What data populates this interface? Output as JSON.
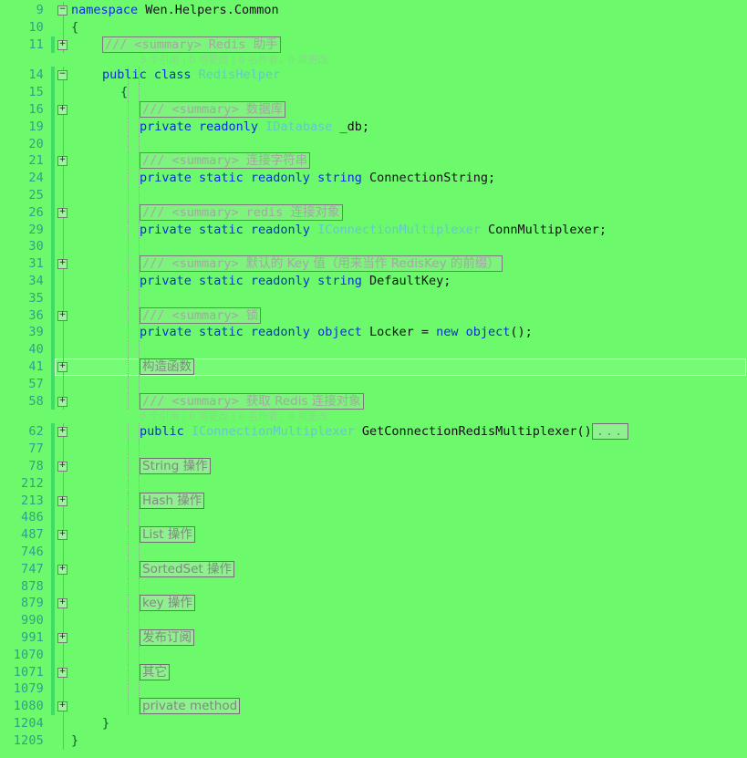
{
  "editor": {
    "app": "visual-studio-code-editor",
    "language": "csharp",
    "background_color": "#6cf96c",
    "keyword_color": "#0a2fd8",
    "type_color": "#66c9c9",
    "text_color": "#101010",
    "linenumber_color": "#2f9f8f",
    "collapsed_text_color": "#7f8a7f",
    "current_line": "41"
  },
  "lines": [
    {
      "num": "9",
      "glyph": "minus",
      "guide": "none",
      "segments": [
        {
          "cls": "kw",
          "text": "namespace"
        },
        {
          "cls": "plain",
          "text": " Wen.Helpers.Common"
        }
      ]
    },
    {
      "num": "10",
      "glyph": "none",
      "guide": "none",
      "segments": [
        {
          "cls": "brace",
          "text": "{"
        }
      ]
    },
    {
      "num": "11",
      "glyph": "plus",
      "guide": "none",
      "summary": "/// <summary> Redis 助手",
      "summary_cn": "助手",
      "summary_ascii": "/// <summary> Redis "
    },
    {
      "num": "",
      "lens": true,
      "lens_text": "3 个引用 | 0 项更改 | 0 名作者，0 项更改"
    },
    {
      "num": "14",
      "glyph": "minus",
      "guide": "none",
      "segments": [
        {
          "cls": "kw",
          "text": "public class"
        },
        {
          "cls": "type",
          "text": " RedisHelper"
        }
      ]
    },
    {
      "num": "15",
      "glyph": "none",
      "segments": [
        {
          "cls": "brace",
          "text": "{"
        }
      ]
    },
    {
      "num": "16",
      "glyph": "plus",
      "summary_ascii": "/// <summary> ",
      "summary_cn": "数据库"
    },
    {
      "num": "19",
      "glyph": "none",
      "segments": [
        {
          "cls": "kw",
          "text": "private readonly"
        },
        {
          "cls": "type",
          "text": " IDatabase"
        },
        {
          "cls": "plain",
          "text": " _db;"
        }
      ]
    },
    {
      "num": "20",
      "glyph": "none",
      "segments": []
    },
    {
      "num": "21",
      "glyph": "plus",
      "summary_ascii": "/// <summary> ",
      "summary_cn": "连接字符串"
    },
    {
      "num": "24",
      "glyph": "none",
      "segments": [
        {
          "cls": "kw",
          "text": "private static readonly string"
        },
        {
          "cls": "plain",
          "text": " ConnectionString;"
        }
      ]
    },
    {
      "num": "25",
      "glyph": "none",
      "segments": []
    },
    {
      "num": "26",
      "glyph": "plus",
      "summary_ascii": "/// <summary> redis ",
      "summary_cn": "连接对象"
    },
    {
      "num": "29",
      "glyph": "none",
      "segments": [
        {
          "cls": "kw",
          "text": "private static readonly"
        },
        {
          "cls": "type",
          "text": " IConnectionMultiplexer"
        },
        {
          "cls": "plain",
          "text": " ConnMultiplexer;"
        }
      ]
    },
    {
      "num": "30",
      "glyph": "none",
      "segments": []
    },
    {
      "num": "31",
      "glyph": "plus",
      "summary_ascii": "/// <summary> ",
      "summary_cn": "默认的 Key 值（用来当作 RedisKey 的前缀）"
    },
    {
      "num": "34",
      "glyph": "none",
      "segments": [
        {
          "cls": "kw",
          "text": "private static readonly string"
        },
        {
          "cls": "plain",
          "text": " DefaultKey;"
        }
      ]
    },
    {
      "num": "35",
      "glyph": "none",
      "segments": []
    },
    {
      "num": "36",
      "glyph": "plus",
      "summary_ascii": "/// <summary> ",
      "summary_cn": "锁"
    },
    {
      "num": "39",
      "glyph": "none",
      "segments": [
        {
          "cls": "kw",
          "text": "private static readonly object"
        },
        {
          "cls": "plain",
          "text": " Locker = "
        },
        {
          "cls": "kw",
          "text": "new object"
        },
        {
          "cls": "plain",
          "text": "();"
        }
      ]
    },
    {
      "num": "40",
      "glyph": "none",
      "segments": []
    },
    {
      "num": "41",
      "glyph": "plus",
      "current": true,
      "collapsed": "构造函数"
    },
    {
      "num": "57",
      "glyph": "none",
      "segments": []
    },
    {
      "num": "58",
      "glyph": "plus",
      "summary_ascii": "/// <summary> ",
      "summary_cn": "获取 Redis 连接对象"
    },
    {
      "num": "",
      "lens": true,
      "lens_text": "0 个引用 | 0 项更改 | 0 名作者，0 项更改"
    },
    {
      "num": "62",
      "glyph": "plus",
      "segments": [
        {
          "cls": "kw",
          "text": "public"
        },
        {
          "cls": "type",
          "text": " IConnectionMultiplexer"
        },
        {
          "cls": "plain",
          "text": " GetConnectionRedisMultiplexer()"
        }
      ],
      "dots": "..."
    },
    {
      "num": "77",
      "glyph": "none",
      "segments": []
    },
    {
      "num": "78",
      "glyph": "plus",
      "collapsed": "String 操作"
    },
    {
      "num": "212",
      "glyph": "none",
      "segments": []
    },
    {
      "num": "213",
      "glyph": "plus",
      "collapsed": "Hash 操作"
    },
    {
      "num": "486",
      "glyph": "none",
      "segments": []
    },
    {
      "num": "487",
      "glyph": "plus",
      "collapsed": "List 操作"
    },
    {
      "num": "746",
      "glyph": "none",
      "segments": []
    },
    {
      "num": "747",
      "glyph": "plus",
      "collapsed": "SortedSet 操作"
    },
    {
      "num": "878",
      "glyph": "none",
      "segments": []
    },
    {
      "num": "879",
      "glyph": "plus",
      "collapsed": "key 操作"
    },
    {
      "num": "990",
      "glyph": "none",
      "segments": []
    },
    {
      "num": "991",
      "glyph": "plus",
      "collapsed": "发布订阅"
    },
    {
      "num": "1070",
      "glyph": "none",
      "segments": []
    },
    {
      "num": "1071",
      "glyph": "plus",
      "collapsed": "其它"
    },
    {
      "num": "1079",
      "glyph": "none",
      "segments": []
    },
    {
      "num": "1080",
      "glyph": "plus",
      "collapsed": "private method"
    },
    {
      "num": "1204",
      "glyph": "none",
      "segments": [
        {
          "cls": "brace",
          "text": "}"
        }
      ]
    },
    {
      "num": "1205",
      "glyph": "none",
      "segments": [
        {
          "cls": "brace",
          "text": "}"
        }
      ]
    }
  ]
}
